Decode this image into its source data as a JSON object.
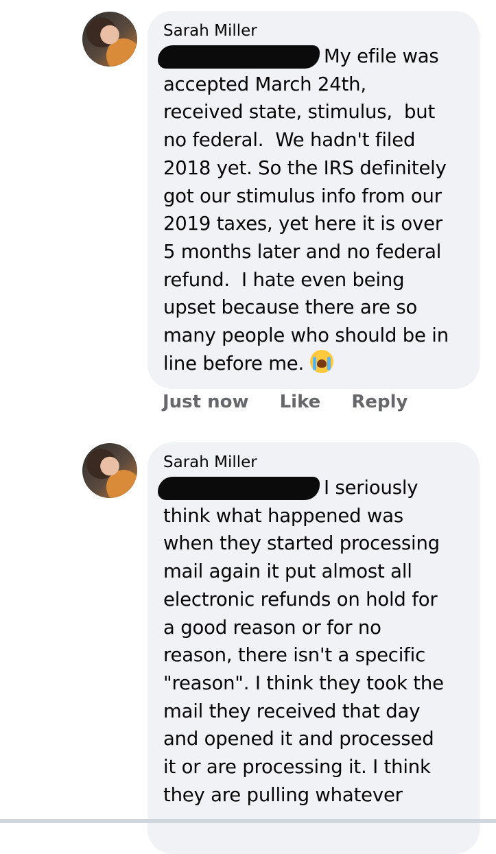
{
  "comments": [
    {
      "author": "Sarah Miller",
      "text": "My efile was\naccepted March 24th,\nreceived state, stimulus,  but\nno federal.  We hadn't filed\n2018 yet. So the IRS definitely\ngot our stimulus info from our\n2019 taxes, yet here it is over\n5 months later and no federal\nrefund.  I hate even being\nupset because there are so\nmany people who should be in\nline before me.",
      "emoji": "loudly-crying-face",
      "actions": {
        "time": "Just now",
        "like": "Like",
        "reply": "Reply"
      }
    },
    {
      "author": "Sarah Miller",
      "text": "I seriously\nthink what happened was\nwhen they started processing\nmail again it put almost all\nelectronic refunds on hold for\na good reason or for no\nreason, there isn't a specific\n\"reason\". I think they took the\nmail they received that day\nand opened it and processed\nit or are processing it. I think\nthey are pulling whatever"
    }
  ]
}
